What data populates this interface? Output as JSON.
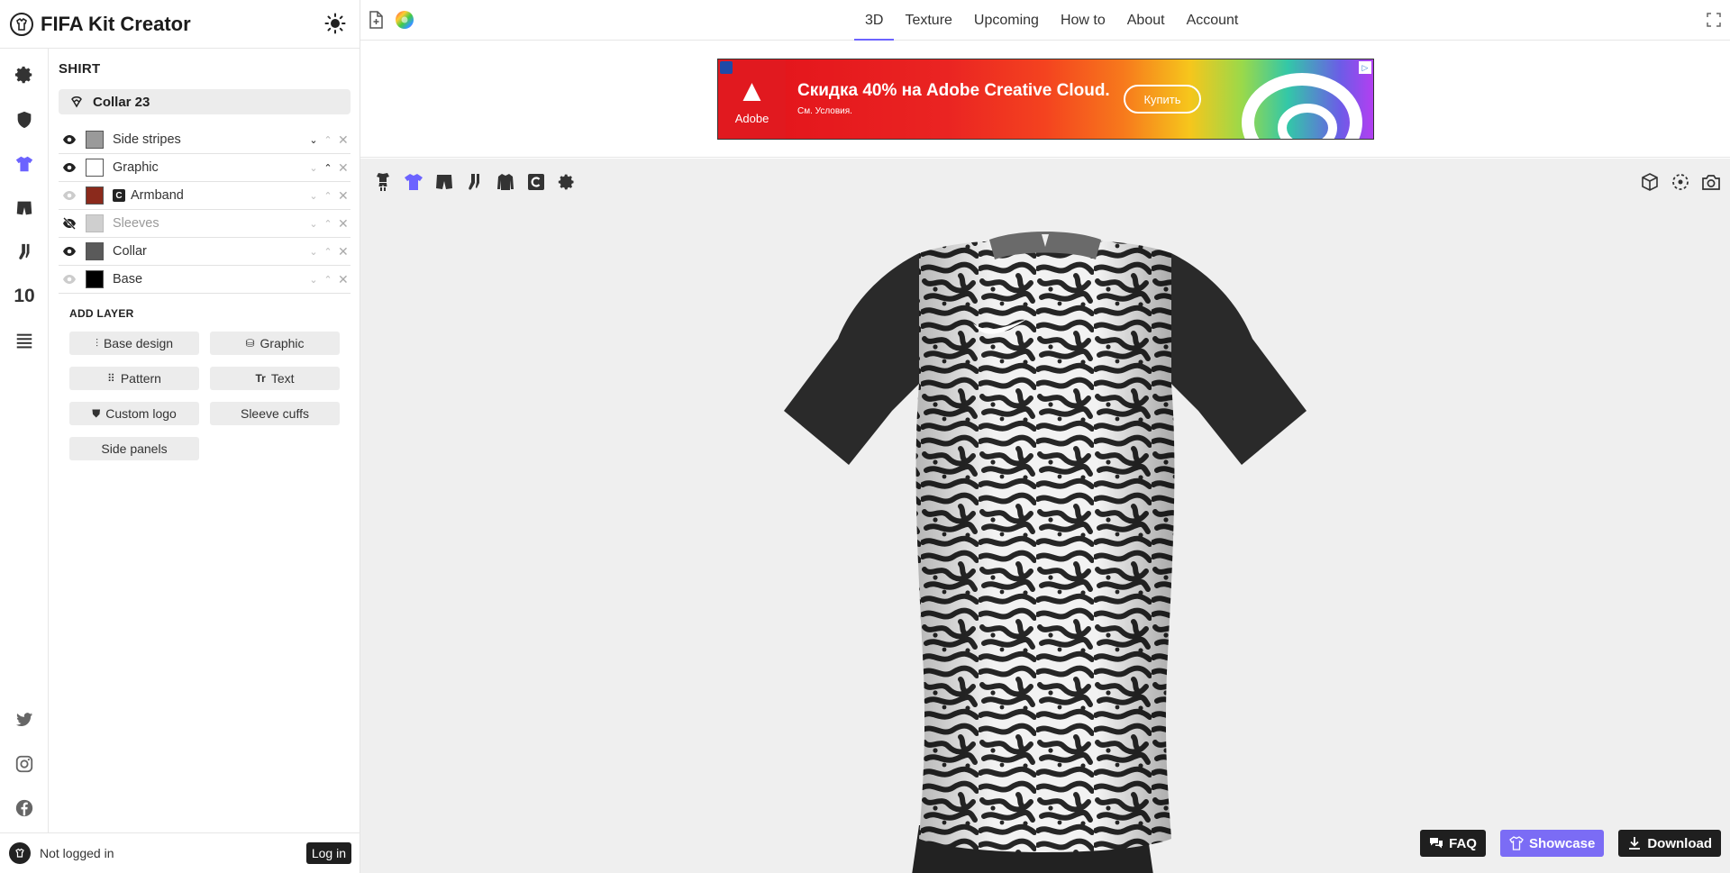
{
  "app": {
    "title": "FIFA Kit Creator"
  },
  "topbar": {
    "tabs": [
      {
        "label": "3D",
        "active": true
      },
      {
        "label": "Texture",
        "active": false
      },
      {
        "label": "Upcoming",
        "active": false
      },
      {
        "label": "How to",
        "active": false
      },
      {
        "label": "About",
        "active": false
      },
      {
        "label": "Account",
        "active": false
      }
    ]
  },
  "sidebar": {
    "rail_number": "10"
  },
  "editor": {
    "section_title": "SHIRT",
    "collar": "Collar 23",
    "layers": [
      {
        "name": "Side stripes",
        "color": "#9a9a9a",
        "visible": true
      },
      {
        "name": "Graphic",
        "color": "#ffffff",
        "visible": true
      },
      {
        "name": "Armband",
        "color": "#8b2a1c",
        "visible": "faded",
        "badge": "C"
      },
      {
        "name": "Sleeves",
        "color": "#cfcfcf",
        "visible": false
      },
      {
        "name": "Collar",
        "color": "#5a5a5a",
        "visible": true
      },
      {
        "name": "Base",
        "color": "#000000",
        "visible": "faded"
      }
    ],
    "add_layer_title": "ADD LAYER",
    "add_buttons": {
      "base_design": "Base design",
      "graphic": "Graphic",
      "pattern": "Pattern",
      "text": "Text",
      "custom_logo": "Custom logo",
      "sleeve_cuffs": "Sleeve cuffs",
      "side_panels": "Side panels"
    },
    "text_button_glyph": "Tr"
  },
  "account": {
    "status": "Not logged in",
    "login_label": "Log in"
  },
  "ad": {
    "brand": "Adobe",
    "headline": "Скидка 40% на Adobe Creative Cloud.",
    "sub": "См. Условия.",
    "cta": "Купить"
  },
  "viewport": {
    "buttons": {
      "faq": "FAQ",
      "showcase": "Showcase",
      "download": "Download"
    }
  },
  "colors": {
    "accent": "#6c63ff",
    "showcase": "#7b6cf5",
    "dark": "#1f1f1f"
  }
}
